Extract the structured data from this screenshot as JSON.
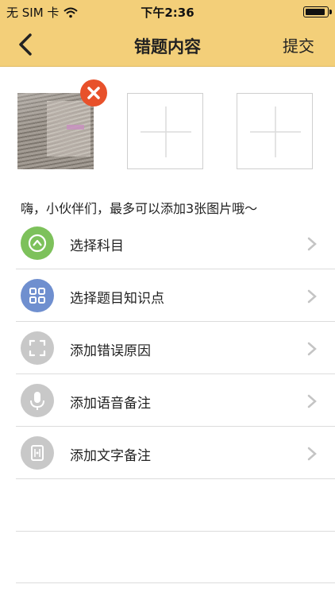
{
  "status_bar": {
    "carrier": "无 SIM 卡",
    "time": "下午2:36"
  },
  "nav": {
    "title": "错题内容",
    "submit_label": "提交"
  },
  "hint": "嗨，小伙伴们，最多可以添加3张图片哦～",
  "menu": {
    "items": [
      {
        "label": "选择科目",
        "icon": "subject-icon",
        "color": "#7dc15b"
      },
      {
        "label": "选择题目知识点",
        "icon": "grid-icon",
        "color": "#6f8fcf"
      },
      {
        "label": "添加错误原因",
        "icon": "scan-frame-icon",
        "color": "#c8c8c8"
      },
      {
        "label": "添加语音备注",
        "icon": "microphone-icon",
        "color": "#c8c8c8"
      },
      {
        "label": "添加文字备注",
        "icon": "document-icon",
        "color": "#c8c8c8"
      }
    ]
  },
  "colors": {
    "header_bg": "#f3cf79",
    "delete_badge": "#e8512b"
  }
}
